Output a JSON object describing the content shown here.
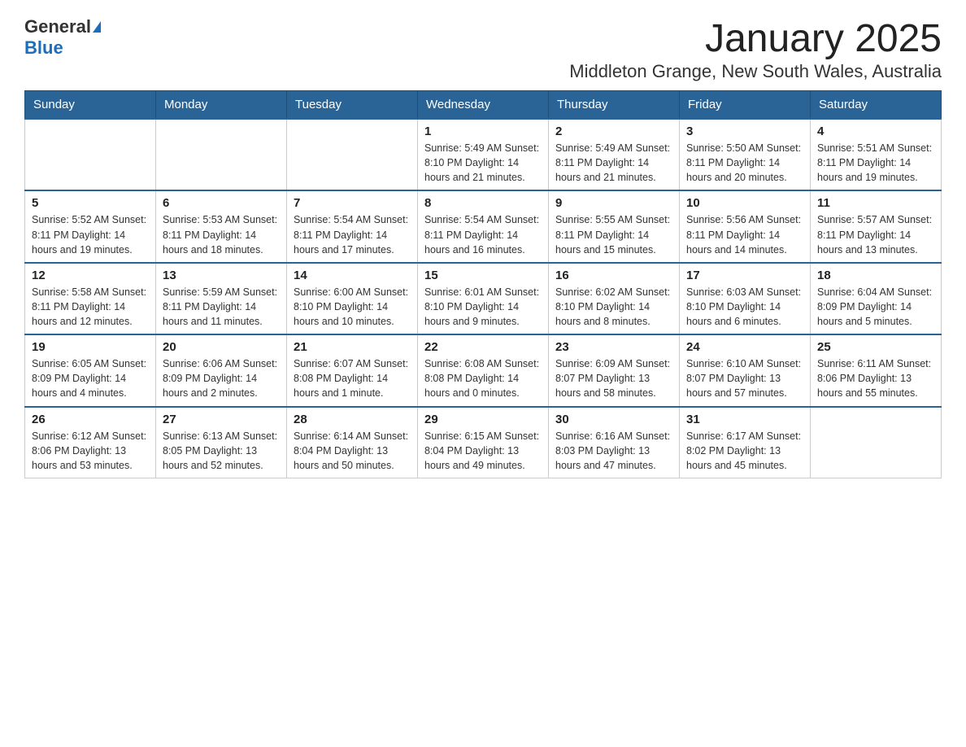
{
  "logo": {
    "text_general": "General",
    "text_blue": "Blue"
  },
  "title": "January 2025",
  "subtitle": "Middleton Grange, New South Wales, Australia",
  "days_of_week": [
    "Sunday",
    "Monday",
    "Tuesday",
    "Wednesday",
    "Thursday",
    "Friday",
    "Saturday"
  ],
  "weeks": [
    [
      {
        "day": "",
        "info": ""
      },
      {
        "day": "",
        "info": ""
      },
      {
        "day": "",
        "info": ""
      },
      {
        "day": "1",
        "info": "Sunrise: 5:49 AM\nSunset: 8:10 PM\nDaylight: 14 hours\nand 21 minutes."
      },
      {
        "day": "2",
        "info": "Sunrise: 5:49 AM\nSunset: 8:11 PM\nDaylight: 14 hours\nand 21 minutes."
      },
      {
        "day": "3",
        "info": "Sunrise: 5:50 AM\nSunset: 8:11 PM\nDaylight: 14 hours\nand 20 minutes."
      },
      {
        "day": "4",
        "info": "Sunrise: 5:51 AM\nSunset: 8:11 PM\nDaylight: 14 hours\nand 19 minutes."
      }
    ],
    [
      {
        "day": "5",
        "info": "Sunrise: 5:52 AM\nSunset: 8:11 PM\nDaylight: 14 hours\nand 19 minutes."
      },
      {
        "day": "6",
        "info": "Sunrise: 5:53 AM\nSunset: 8:11 PM\nDaylight: 14 hours\nand 18 minutes."
      },
      {
        "day": "7",
        "info": "Sunrise: 5:54 AM\nSunset: 8:11 PM\nDaylight: 14 hours\nand 17 minutes."
      },
      {
        "day": "8",
        "info": "Sunrise: 5:54 AM\nSunset: 8:11 PM\nDaylight: 14 hours\nand 16 minutes."
      },
      {
        "day": "9",
        "info": "Sunrise: 5:55 AM\nSunset: 8:11 PM\nDaylight: 14 hours\nand 15 minutes."
      },
      {
        "day": "10",
        "info": "Sunrise: 5:56 AM\nSunset: 8:11 PM\nDaylight: 14 hours\nand 14 minutes."
      },
      {
        "day": "11",
        "info": "Sunrise: 5:57 AM\nSunset: 8:11 PM\nDaylight: 14 hours\nand 13 minutes."
      }
    ],
    [
      {
        "day": "12",
        "info": "Sunrise: 5:58 AM\nSunset: 8:11 PM\nDaylight: 14 hours\nand 12 minutes."
      },
      {
        "day": "13",
        "info": "Sunrise: 5:59 AM\nSunset: 8:11 PM\nDaylight: 14 hours\nand 11 minutes."
      },
      {
        "day": "14",
        "info": "Sunrise: 6:00 AM\nSunset: 8:10 PM\nDaylight: 14 hours\nand 10 minutes."
      },
      {
        "day": "15",
        "info": "Sunrise: 6:01 AM\nSunset: 8:10 PM\nDaylight: 14 hours\nand 9 minutes."
      },
      {
        "day": "16",
        "info": "Sunrise: 6:02 AM\nSunset: 8:10 PM\nDaylight: 14 hours\nand 8 minutes."
      },
      {
        "day": "17",
        "info": "Sunrise: 6:03 AM\nSunset: 8:10 PM\nDaylight: 14 hours\nand 6 minutes."
      },
      {
        "day": "18",
        "info": "Sunrise: 6:04 AM\nSunset: 8:09 PM\nDaylight: 14 hours\nand 5 minutes."
      }
    ],
    [
      {
        "day": "19",
        "info": "Sunrise: 6:05 AM\nSunset: 8:09 PM\nDaylight: 14 hours\nand 4 minutes."
      },
      {
        "day": "20",
        "info": "Sunrise: 6:06 AM\nSunset: 8:09 PM\nDaylight: 14 hours\nand 2 minutes."
      },
      {
        "day": "21",
        "info": "Sunrise: 6:07 AM\nSunset: 8:08 PM\nDaylight: 14 hours\nand 1 minute."
      },
      {
        "day": "22",
        "info": "Sunrise: 6:08 AM\nSunset: 8:08 PM\nDaylight: 14 hours\nand 0 minutes."
      },
      {
        "day": "23",
        "info": "Sunrise: 6:09 AM\nSunset: 8:07 PM\nDaylight: 13 hours\nand 58 minutes."
      },
      {
        "day": "24",
        "info": "Sunrise: 6:10 AM\nSunset: 8:07 PM\nDaylight: 13 hours\nand 57 minutes."
      },
      {
        "day": "25",
        "info": "Sunrise: 6:11 AM\nSunset: 8:06 PM\nDaylight: 13 hours\nand 55 minutes."
      }
    ],
    [
      {
        "day": "26",
        "info": "Sunrise: 6:12 AM\nSunset: 8:06 PM\nDaylight: 13 hours\nand 53 minutes."
      },
      {
        "day": "27",
        "info": "Sunrise: 6:13 AM\nSunset: 8:05 PM\nDaylight: 13 hours\nand 52 minutes."
      },
      {
        "day": "28",
        "info": "Sunrise: 6:14 AM\nSunset: 8:04 PM\nDaylight: 13 hours\nand 50 minutes."
      },
      {
        "day": "29",
        "info": "Sunrise: 6:15 AM\nSunset: 8:04 PM\nDaylight: 13 hours\nand 49 minutes."
      },
      {
        "day": "30",
        "info": "Sunrise: 6:16 AM\nSunset: 8:03 PM\nDaylight: 13 hours\nand 47 minutes."
      },
      {
        "day": "31",
        "info": "Sunrise: 6:17 AM\nSunset: 8:02 PM\nDaylight: 13 hours\nand 45 minutes."
      },
      {
        "day": "",
        "info": ""
      }
    ]
  ]
}
